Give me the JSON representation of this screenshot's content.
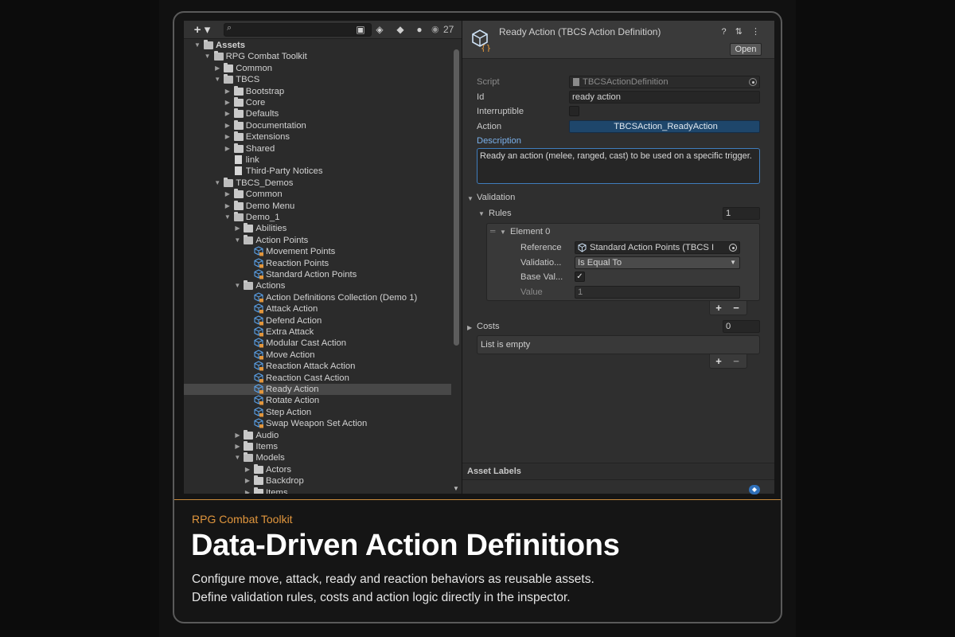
{
  "project_window": {
    "add_label": "+ ▾",
    "search_placeholder": "",
    "hidden_count": "27",
    "tree": [
      {
        "label": "Assets",
        "depth": 0,
        "kind": "folder",
        "expanded": true,
        "bold": true
      },
      {
        "label": "RPG Combat Toolkit",
        "depth": 1,
        "kind": "folder",
        "expanded": true
      },
      {
        "label": "Common",
        "depth": 2,
        "kind": "folder",
        "expanded": false
      },
      {
        "label": "TBCS",
        "depth": 2,
        "kind": "folder",
        "expanded": true
      },
      {
        "label": "Bootstrap",
        "depth": 3,
        "kind": "folder",
        "expanded": false
      },
      {
        "label": "Core",
        "depth": 3,
        "kind": "folder",
        "expanded": false
      },
      {
        "label": "Defaults",
        "depth": 3,
        "kind": "folder",
        "expanded": false
      },
      {
        "label": "Documentation",
        "depth": 3,
        "kind": "folder",
        "expanded": false
      },
      {
        "label": "Extensions",
        "depth": 3,
        "kind": "folder",
        "expanded": false
      },
      {
        "label": "Shared",
        "depth": 3,
        "kind": "folder",
        "expanded": false
      },
      {
        "label": "link",
        "depth": 3,
        "kind": "doc"
      },
      {
        "label": "Third-Party Notices",
        "depth": 3,
        "kind": "doc"
      },
      {
        "label": "TBCS_Demos",
        "depth": 2,
        "kind": "folder",
        "expanded": true
      },
      {
        "label": "Common",
        "depth": 3,
        "kind": "folder",
        "expanded": false
      },
      {
        "label": "Demo Menu",
        "depth": 3,
        "kind": "folder",
        "expanded": false
      },
      {
        "label": "Demo_1",
        "depth": 3,
        "kind": "folder",
        "expanded": true
      },
      {
        "label": "Abilities",
        "depth": 4,
        "kind": "folder",
        "expanded": false
      },
      {
        "label": "Action Points",
        "depth": 4,
        "kind": "folder",
        "expanded": true
      },
      {
        "label": "Movement Points",
        "depth": 5,
        "kind": "asset"
      },
      {
        "label": "Reaction Points",
        "depth": 5,
        "kind": "asset"
      },
      {
        "label": "Standard Action Points",
        "depth": 5,
        "kind": "asset"
      },
      {
        "label": "Actions",
        "depth": 4,
        "kind": "folder",
        "expanded": true
      },
      {
        "label": "Action Definitions Collection (Demo 1)",
        "depth": 5,
        "kind": "asset"
      },
      {
        "label": "Attack Action",
        "depth": 5,
        "kind": "asset"
      },
      {
        "label": "Defend Action",
        "depth": 5,
        "kind": "asset"
      },
      {
        "label": "Extra Attack",
        "depth": 5,
        "kind": "asset"
      },
      {
        "label": "Modular Cast Action",
        "depth": 5,
        "kind": "asset"
      },
      {
        "label": "Move Action",
        "depth": 5,
        "kind": "asset"
      },
      {
        "label": "Reaction Attack Action",
        "depth": 5,
        "kind": "asset"
      },
      {
        "label": "Reaction Cast Action",
        "depth": 5,
        "kind": "asset"
      },
      {
        "label": "Ready Action",
        "depth": 5,
        "kind": "asset",
        "selected": true
      },
      {
        "label": "Rotate Action",
        "depth": 5,
        "kind": "asset"
      },
      {
        "label": "Step Action",
        "depth": 5,
        "kind": "asset"
      },
      {
        "label": "Swap Weapon Set Action",
        "depth": 5,
        "kind": "asset"
      },
      {
        "label": "Audio",
        "depth": 4,
        "kind": "folder",
        "expanded": false
      },
      {
        "label": "Items",
        "depth": 4,
        "kind": "folder",
        "expanded": false
      },
      {
        "label": "Models",
        "depth": 4,
        "kind": "folder",
        "expanded": true
      },
      {
        "label": "Actors",
        "depth": 5,
        "kind": "folder",
        "expanded": false
      },
      {
        "label": "Backdrop",
        "depth": 5,
        "kind": "folder",
        "expanded": false
      },
      {
        "label": "Items",
        "depth": 5,
        "kind": "folder",
        "expanded": false
      }
    ]
  },
  "inspector": {
    "title": "Ready Action (TBCS Action Definition)",
    "tools": "? ⇅ ⋮",
    "open_label": "Open",
    "script_label": "Script",
    "script_value": "TBCSActionDefinition",
    "id_label": "Id",
    "id_value": "ready action",
    "interruptible_label": "Interruptible",
    "interruptible_checked": false,
    "action_label": "Action",
    "action_value": "TBCSAction_ReadyAction",
    "description_label": "Description",
    "description_value": "Ready an action (melee, ranged, cast) to be used on a specific trigger.",
    "validation_label": "Validation",
    "rules_label": "Rules",
    "rules_count": "1",
    "element_label": "Element 0",
    "reference_label": "Reference",
    "reference_value": "Standard Action Points (TBCS I",
    "validation_op_label": "Validatio...",
    "validation_op_value": "Is Equal To",
    "base_value_label": "Base Val...",
    "base_value_checked": true,
    "value_label": "Value",
    "value_value": "1",
    "costs_label": "Costs",
    "costs_count": "0",
    "costs_empty": "List is empty",
    "plus": "+",
    "minus": "−",
    "asset_labels": "Asset Labels"
  },
  "caption": {
    "brand": "RPG Combat Toolkit",
    "title": "Data-Driven Action Definitions",
    "line1": "Configure move, attack, ready and reaction behaviors as reusable assets.",
    "line2": "Define validation rules, costs and action logic directly in the inspector."
  },
  "colors": {
    "accent": "#e1963d",
    "selection": "#484848",
    "action_field": "#1e466b",
    "asset_icon": "#5aa0e6"
  }
}
